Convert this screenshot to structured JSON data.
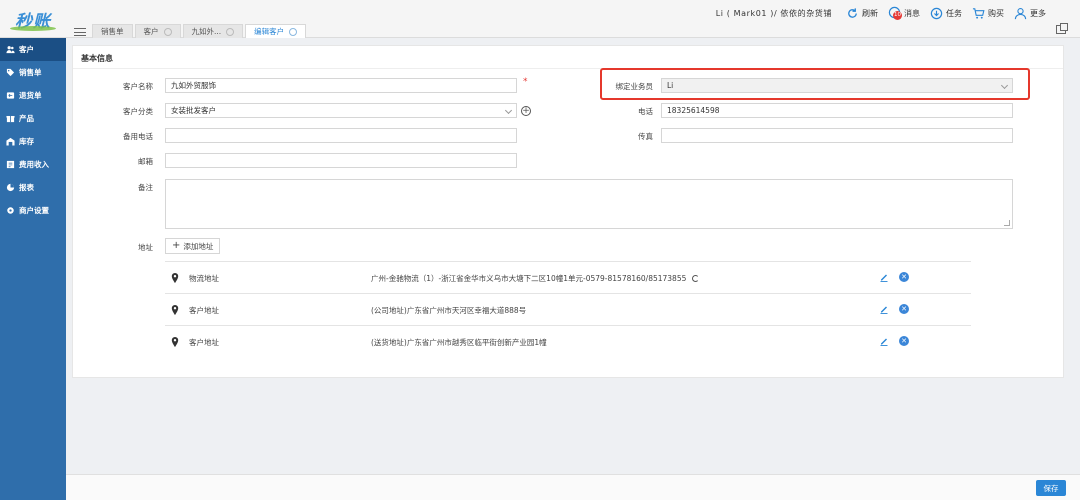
{
  "app": {
    "logo_text": "秒账"
  },
  "tabs": [
    {
      "label": "销售单",
      "active": false
    },
    {
      "label": "客户",
      "active": false
    },
    {
      "label": "九如外...",
      "active": false
    },
    {
      "label": "编辑客户",
      "active": true
    }
  ],
  "header": {
    "user_info": "Li ( Mark01 )/ 依依的杂货铺",
    "actions": {
      "refresh": "刷新",
      "messages": "消息",
      "message_count": "10",
      "tasks": "任务",
      "buy": "购买",
      "more": "更多"
    }
  },
  "sidebar": {
    "items": [
      {
        "label": "客户",
        "icon": "users-icon",
        "active": true
      },
      {
        "label": "销售单",
        "icon": "tag-icon",
        "active": false
      },
      {
        "label": "退货单",
        "icon": "return-icon",
        "active": false
      },
      {
        "label": "产品",
        "icon": "gift-icon",
        "active": false
      },
      {
        "label": "库存",
        "icon": "warehouse-icon",
        "active": false
      },
      {
        "label": "费用收入",
        "icon": "ledger-icon",
        "active": false
      },
      {
        "label": "报表",
        "icon": "pie-chart-icon",
        "active": false
      },
      {
        "label": "商户设置",
        "icon": "gear-icon",
        "active": false
      }
    ]
  },
  "form": {
    "section_title": "基本信息",
    "customer_name": {
      "label": "客户名称",
      "value": "九如外贸服饰"
    },
    "salesperson": {
      "label": "绑定业务员",
      "value": "Li"
    },
    "category": {
      "label": "客户分类",
      "value": "女装批发客户"
    },
    "phone": {
      "label": "电话",
      "value": "18325614598"
    },
    "backup_phone": {
      "label": "备用电话",
      "value": ""
    },
    "fax": {
      "label": "传真",
      "value": ""
    },
    "email": {
      "label": "邮箱",
      "value": ""
    },
    "remark": {
      "label": "备注",
      "value": ""
    },
    "address_label": "地址",
    "add_address_label": "添加地址",
    "addresses": [
      {
        "type": "物流地址",
        "text": "广州-金驰物流（1）-浙江省金华市义乌市大塘下二区10幢1单元-0579-81578160/85173855"
      },
      {
        "type": "客户地址",
        "text": "(公司地址)广东省广州市天河区幸福大道888号"
      },
      {
        "type": "客户地址",
        "text": "(送货地址)广东省广州市越秀区临平街创新产业园1幢"
      }
    ]
  },
  "footer": {
    "save_label": "保存"
  },
  "colors": {
    "primary": "#2a86d6",
    "sidebar": "#2f6eab",
    "sidebar_active": "#1b4f85",
    "highlight": "#e5382c",
    "required": "#e53935"
  }
}
